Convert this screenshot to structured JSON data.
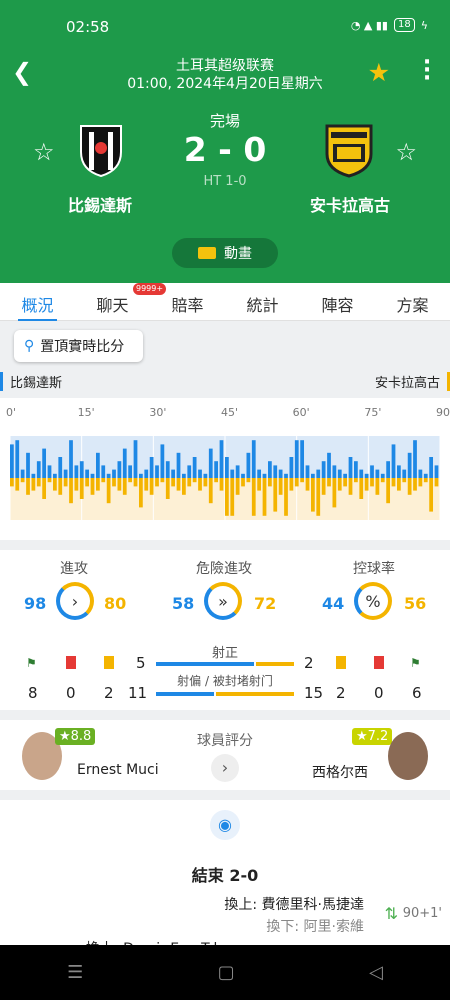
{
  "status": {
    "time": "02:58",
    "battery": "18"
  },
  "header": {
    "league": "土耳其超级联赛",
    "datetime": "01:00, 2024年4月20日星期六",
    "state": "完場",
    "score": "2 - 0",
    "halftime": "HT 1-0",
    "home": "比錫達斯",
    "away": "安卡拉高古",
    "animation": "動畫"
  },
  "tabs": [
    "概況",
    "聊天",
    "賠率",
    "統計",
    "陣容",
    "方案"
  ],
  "chat_badge": "9999+",
  "pin_label": "置頂實時比分",
  "timeline": {
    "home": "比錫達斯",
    "away": "安卡拉高古",
    "minutes": [
      "0'",
      "15'",
      "30'",
      "45'",
      "60'",
      "75'",
      "90'"
    ],
    "home_pressure": [
      0.8,
      0.9,
      0.2,
      0.6,
      0.1,
      0.4,
      0.7,
      0.3,
      0.1,
      0.5,
      0.2,
      0.9,
      0.3,
      0.4,
      0.2,
      0.1,
      0.6,
      0.3,
      0.1,
      0.2,
      0.4,
      0.7,
      0.3,
      0.9,
      0.1,
      0.2,
      0.5,
      0.3,
      0.8,
      0.4,
      0.2,
      0.6,
      0.1,
      0.3,
      0.5,
      0.2,
      0.1,
      0.7,
      0.4,
      0.9,
      0.5,
      0.2,
      0.3,
      0.1,
      0.6,
      0.9,
      0.2,
      0.1,
      0.4,
      0.3,
      0.2,
      0.1,
      0.5,
      0.9,
      0.9,
      0.3,
      0.1,
      0.2,
      0.4,
      0.6,
      0.3,
      0.2,
      0.1,
      0.5,
      0.4,
      0.2,
      0.1,
      0.3,
      0.2,
      0.1,
      0.4,
      0.8,
      0.3,
      0.2,
      0.6,
      0.9,
      0.2,
      0.1,
      0.5,
      0.3
    ],
    "away_pressure": [
      0.2,
      0.3,
      0.1,
      0.4,
      0.3,
      0.2,
      0.5,
      0.1,
      0.3,
      0.4,
      0.2,
      0.6,
      0.3,
      0.5,
      0.2,
      0.4,
      0.3,
      0.1,
      0.6,
      0.2,
      0.3,
      0.4,
      0.1,
      0.2,
      0.7,
      0.3,
      0.4,
      0.2,
      0.1,
      0.5,
      0.2,
      0.3,
      0.4,
      0.2,
      0.1,
      0.3,
      0.2,
      0.6,
      0.1,
      0.3,
      0.9,
      0.9,
      0.4,
      0.2,
      0.1,
      0.9,
      0.3,
      0.9,
      0.2,
      0.8,
      0.4,
      0.9,
      0.3,
      0.2,
      0.1,
      0.3,
      0.8,
      0.9,
      0.4,
      0.2,
      0.7,
      0.3,
      0.2,
      0.4,
      0.1,
      0.5,
      0.3,
      0.2,
      0.4,
      0.1,
      0.6,
      0.2,
      0.3,
      0.1,
      0.4,
      0.3,
      0.2,
      0.1,
      0.8,
      0.2
    ]
  },
  "stats": {
    "attack": {
      "label": "進攻",
      "home": "98",
      "away": "80"
    },
    "danger": {
      "label": "危險進攻",
      "home": "58",
      "away": "72"
    },
    "possession": {
      "label": "控球率",
      "home": "44",
      "away": "56",
      "symbol": "%"
    },
    "shots_on": {
      "label": "射正",
      "home": "5",
      "away": "2"
    },
    "shots_off": {
      "label": "射偏 / 被封堵射门",
      "home": "11",
      "away": "15"
    },
    "home_corners": "8",
    "home_red": "0",
    "home_yellow": "2",
    "away_corners": "6",
    "away_red": "0",
    "away_yellow": "2"
  },
  "ratings": {
    "title": "球員評分",
    "home_player": "Ernest Muci",
    "home_score": "★8.8",
    "away_player": "西格尔西",
    "away_score": "★7.2"
  },
  "events": {
    "result": "結束 2-0",
    "sub_in": "換上: 費德里科·馬捷達",
    "sub_out": "換下: 阿里·索維",
    "minute": "90+1'",
    "next": "換上: Demir Ege Tıknaz"
  },
  "colors": {
    "green": "#1e9a4a",
    "blue": "#1e88e5",
    "yellow": "#f4b400"
  }
}
